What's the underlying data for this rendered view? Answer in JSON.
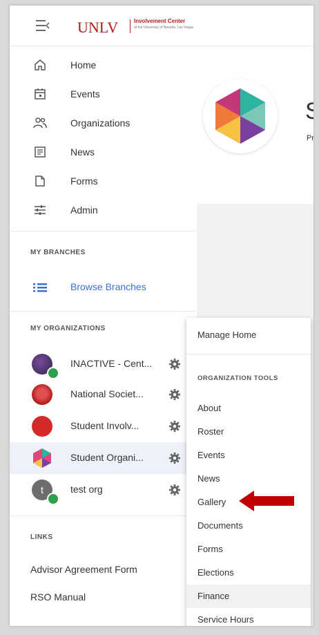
{
  "header": {
    "logo_main": "UNLV",
    "logo_sub": "Involvement Center",
    "logo_tagline": "at the University of Nevada, Las Vegas"
  },
  "sidebar": {
    "nav": [
      {
        "label": "Home",
        "icon": "home-icon"
      },
      {
        "label": "Events",
        "icon": "calendar-icon"
      },
      {
        "label": "Organizations",
        "icon": "people-icon"
      },
      {
        "label": "News",
        "icon": "news-icon"
      },
      {
        "label": "Forms",
        "icon": "forms-icon"
      },
      {
        "label": "Admin",
        "icon": "sliders-icon"
      }
    ],
    "branches_label": "MY BRANCHES",
    "browse_label": "Browse Branches",
    "orgs_label": "MY ORGANIZATIONS",
    "orgs": [
      {
        "name": "INACTIVE - Cent...",
        "locked": true
      },
      {
        "name": "National Societ...",
        "locked": false
      },
      {
        "name": "Student Involv...",
        "locked": false
      },
      {
        "name": "Student Organi...",
        "locked": false,
        "selected": true
      },
      {
        "name": "test org",
        "initial": "t",
        "locked": true
      }
    ],
    "links_label": "LINKS",
    "links": [
      "Advisor Agreement Form",
      "RSO Manual"
    ]
  },
  "main": {
    "title_initial": "S",
    "subtitle_initial": "Pri"
  },
  "dropdown": {
    "manage_home": "Manage Home",
    "tools_label": "ORGANIZATION TOOLS",
    "items": [
      "About",
      "Roster",
      "Events",
      "News",
      "Gallery",
      "Documents",
      "Forms",
      "Elections",
      "Finance",
      "Service Hours"
    ],
    "highlighted": "Finance"
  },
  "colors": {
    "brand_red": "#b31b1b",
    "link_blue": "#3a6fd8",
    "lock_green": "#2e9e4f",
    "arrow_red": "#c00000"
  }
}
